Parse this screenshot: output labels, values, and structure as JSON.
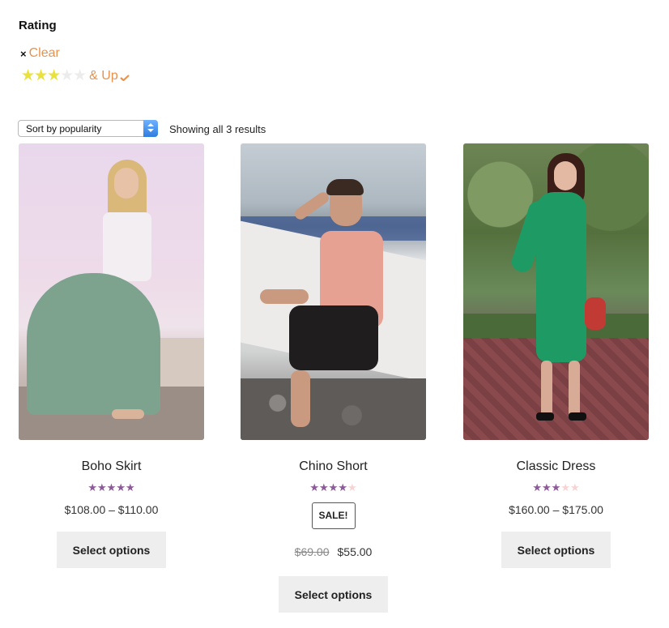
{
  "filter": {
    "title": "Rating",
    "clear_x": "×",
    "clear_label": "Clear",
    "and_up_label": "& Up",
    "selected_rating": 3,
    "max_rating": 5,
    "star_color": "#e8e23a",
    "link_color": "#e8924e"
  },
  "toolbar": {
    "sort_selected": "Sort by popularity",
    "result_count": "Showing all 3 results"
  },
  "products": [
    {
      "title": "Boho Skirt",
      "rating": 5,
      "price": "$108.00 – $110.00",
      "button": "Select options",
      "image": "woman-in-green-maxi-skirt-photo"
    },
    {
      "title": "Chino Short",
      "rating": 4,
      "sale_badge": "SALE!",
      "old_price": "$69.00",
      "new_price": "$55.00",
      "button": "Select options",
      "image": "man-sitting-on-boat-photo"
    },
    {
      "title": "Classic Dress",
      "rating": 3,
      "price": "$160.00 – $175.00",
      "button": "Select options",
      "image": "woman-in-green-dress-photo"
    }
  ],
  "colors": {
    "product_star": "#8b5a9a",
    "product_star_empty": "#f6d4d3",
    "button_bg": "#eeeeee"
  }
}
